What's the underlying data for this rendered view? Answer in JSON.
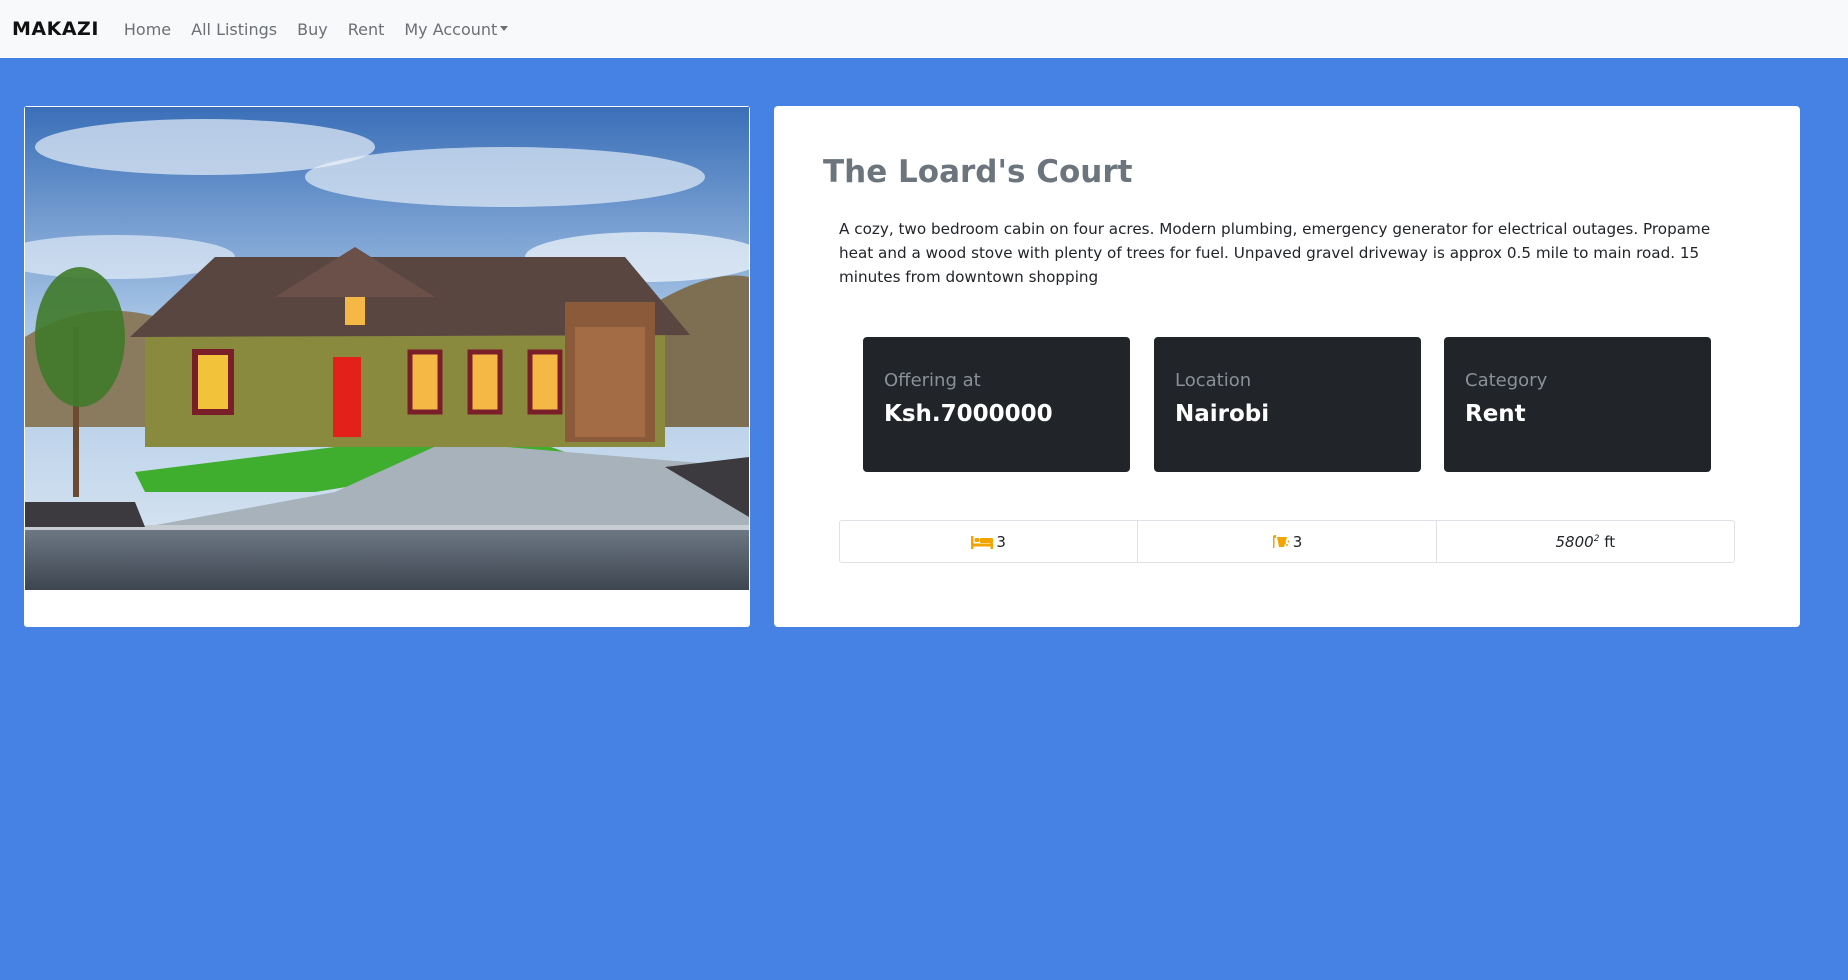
{
  "navbar": {
    "brand": "MAKAZI",
    "links": [
      "Home",
      "All Listings",
      "Buy",
      "Rent"
    ],
    "account_label": "My Account"
  },
  "listing": {
    "title": "The Loard's Court",
    "description": "A cozy, two bedroom cabin on four acres. Modern plumbing, emergency generator for electrical outages. Propame heat and a wood stove with plenty of trees for fuel. Unpaved gravel driveway is approx 0.5 mile to main road. 15 minutes from downtown shopping",
    "info": [
      {
        "label": "Offering at",
        "value": "Ksh.7000000"
      },
      {
        "label": "Location",
        "value": "Nairobi"
      },
      {
        "label": "Category",
        "value": "Rent"
      }
    ],
    "features": {
      "bedrooms": "3",
      "bathrooms": "3",
      "area_value": "5800",
      "area_exp": "2",
      "area_unit": "ft"
    }
  },
  "colors": {
    "page_bg": "#4682e4",
    "navbar_bg": "#f8f9fa",
    "dark_box": "#212529",
    "icon_accent": "#f0a500"
  },
  "icons": {
    "bed": "bed-icon",
    "bath": "bath-icon"
  }
}
